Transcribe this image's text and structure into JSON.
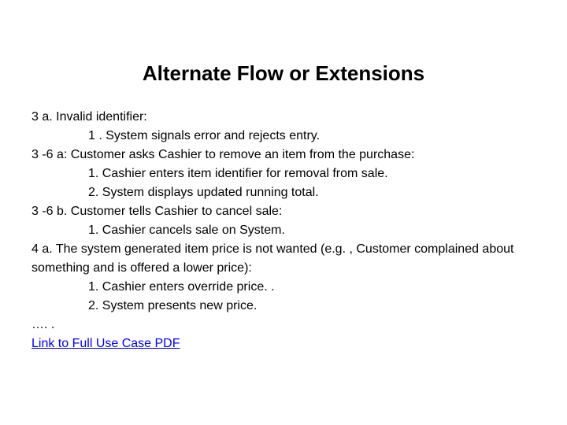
{
  "title": "Alternate Flow or Extensions",
  "lines": {
    "l0": "3 a. Invalid identifier:",
    "l1": "1 . System signals error and rejects entry.",
    "l2": "3 -6 a: Customer asks Cashier to remove an item from the purchase:",
    "l3": "1. Cashier enters item identifier for removal from sale.",
    "l4": "2. System displays updated running total.",
    "l5": "3 -6 b. Customer tells Cashier to cancel sale:",
    "l6": "1. Cashier cancels sale on System.",
    "l7": "4 a. The system generated item price is not wanted (e.g. , Customer complained about something and is offered a lower price):",
    "l8": "1. Cashier enters override price. .",
    "l9": "2. System presents new price.",
    "l10": "…. .",
    "link": "Link to Full Use Case PDF"
  }
}
